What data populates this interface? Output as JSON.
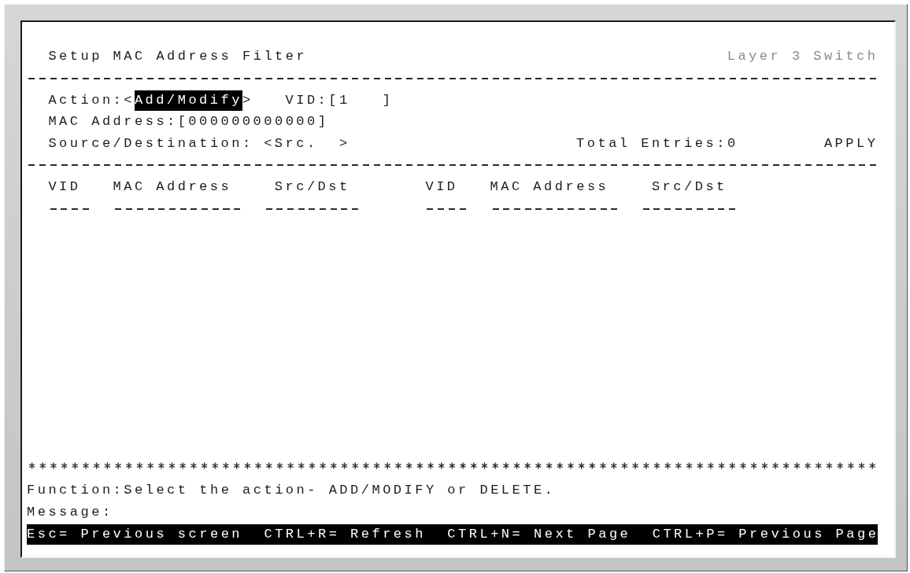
{
  "screen": {
    "title": "Setup MAC Address Filter",
    "device": "Layer 3 Switch"
  },
  "form": {
    "action": {
      "label": "Action:",
      "open": "<",
      "value": "Add/Modify",
      "close": ">",
      "focused": true
    },
    "vid": {
      "label": "VID:",
      "open": "[",
      "value": "1",
      "close": "]",
      "focused": false
    },
    "mac_address": {
      "label": "MAC Address:",
      "open": "[",
      "value": "000000000000",
      "close": "]",
      "focused": false
    },
    "source_destination": {
      "label": "Source/Destination:",
      "open": "<",
      "value": "Src.",
      "close": ">",
      "focused": false
    },
    "total_entries": "Total Entries:0",
    "apply_button": "APPLY"
  },
  "table": {
    "columns": [
      "VID",
      "MAC Address",
      "Src/Dst",
      "VID",
      "MAC Address",
      "Src/Dst"
    ]
  },
  "footer": {
    "function": "Function:Select the action- ADD/MODIFY or DELETE.",
    "message": "Message:",
    "key_hints": [
      "Esc= Previous screen",
      "CTRL+R= Refresh",
      "CTRL+N= Next Page",
      "CTRL+P= Previous Page"
    ]
  }
}
